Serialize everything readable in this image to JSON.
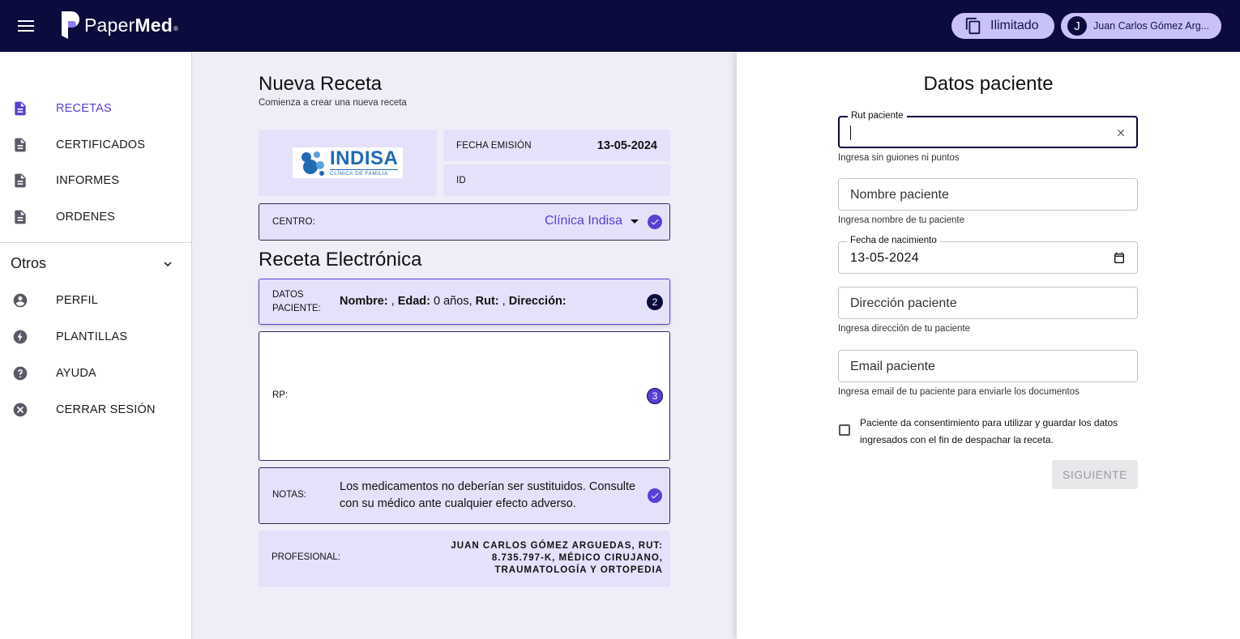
{
  "app": {
    "brand": "PaperMed",
    "brand_light": "Paper",
    "brand_bold": "Med",
    "brand_reg": "®"
  },
  "header": {
    "plan_label": "Ilimitado",
    "user_initial": "J",
    "user_name": "Juan Carlos Gómez Arg..."
  },
  "sidebar": {
    "items": [
      {
        "label": "RECETAS",
        "icon": "document-icon",
        "active": true
      },
      {
        "label": "CERTIFICADOS",
        "icon": "document-icon"
      },
      {
        "label": "INFORMES",
        "icon": "document-icon"
      },
      {
        "label": "ORDENES",
        "icon": "document-icon"
      }
    ],
    "section_label": "Otros",
    "other_items": [
      {
        "label": "PERFIL",
        "icon": "account-circle-icon"
      },
      {
        "label": "PLANTILLAS",
        "icon": "bolt-icon"
      },
      {
        "label": "AYUDA",
        "icon": "help-icon"
      },
      {
        "label": "CERRAR SESIÓN",
        "icon": "cancel-icon"
      }
    ]
  },
  "recipe": {
    "title": "Nueva Receta",
    "subtitle": "Comienza a crear una nueva receta",
    "logo_big": "INDISA",
    "logo_small": "CLÍNICA DE FAMILIA",
    "fecha_label": "FECHA EMISIÓN",
    "fecha_value": "13-05-2024",
    "id_label": "ID",
    "centro_label": "CENTRO:",
    "centro_value": "Clínica Indisa",
    "section_title": "Receta Electrónica",
    "datos_label": "DATOS PACIENTE:",
    "datos_nombre_label": "Nombre:",
    "datos_nombre_value": " , ",
    "datos_edad_label": "Edad:",
    "datos_edad_value": " 0 años, ",
    "datos_rut_label": "Rut:",
    "datos_rut_value": " , ",
    "datos_direccion_label": "Dirección:",
    "datos_step": "2",
    "rp_label": "RP:",
    "rp_step": "3",
    "notas_label": "NOTAS:",
    "notas_text": "Los medicamentos no deberían ser sustituidos. Consulte con su médico ante cualquier efecto adverso.",
    "prof_label": "PROFESIONAL:",
    "prof_text": "JUAN CARLOS GÓMEZ ARGUEDAS, RUT: 8.735.797-K, MÉDICO CIRUJANO, TRAUMATOLOGÍA Y ORTOPEDIA"
  },
  "patient_form": {
    "title": "Datos paciente",
    "rut_label": "Rut paciente",
    "rut_value": "",
    "rut_helper": "Ingresa sin guiones ni puntos",
    "nombre_placeholder": "Nombre paciente",
    "nombre_helper": "Ingresa nombre de tu paciente",
    "fecha_label": "Fecha de nacimiento",
    "fecha_value": "13-05-2024",
    "direccion_placeholder": "Dirección paciente",
    "direccion_helper": "Ingresa dirección de tu paciente",
    "email_placeholder": "Email paciente",
    "email_helper": "Ingresa email de tu paciente para enviarle los documentos",
    "consent_text": "Paciente da consentimiento para utilizar y guardar los datos ingresados con el fin de despachar la receta.",
    "next_label": "SIGUIENTE"
  },
  "colors": {
    "topbar": "#0c0b3d",
    "accent": "#5b3fd4",
    "card_bg": "#e5e1fb",
    "center_bg": "#eeeef8",
    "pill_bg": "#c9c2f7"
  }
}
